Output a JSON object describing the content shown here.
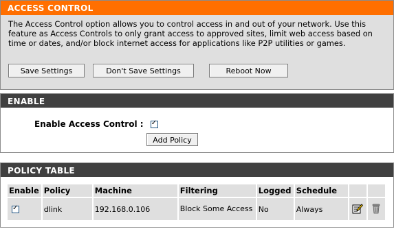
{
  "access_control": {
    "title": "ACCESS CONTROL",
    "description": "The Access Control option allows you to control access in and out of your network. Use this feature as Access Controls to only grant access to approved sites, limit web access based on time or dates, and/or block internet access for applications like P2P utilities or games.",
    "buttons": {
      "save": "Save Settings",
      "dont_save": "Don't Save Settings",
      "reboot": "Reboot Now"
    }
  },
  "enable": {
    "title": "ENABLE",
    "label": "Enable Access Control :",
    "checked": true,
    "add_policy": "Add Policy"
  },
  "policy_table": {
    "title": "POLICY TABLE",
    "columns": [
      "Enable",
      "Policy",
      "Machine",
      "Filtering",
      "Logged",
      "Schedule"
    ],
    "rows": [
      {
        "enable": true,
        "policy": "dlink",
        "machine": "192.168.0.106",
        "filtering": "Block Some Access",
        "logged": "No",
        "schedule": "Always"
      }
    ]
  },
  "colors": {
    "accent": "#ff6f00",
    "section_header": "#404040",
    "panel": "#dfdfdf"
  },
  "icons": [
    "edit-icon",
    "trash-icon"
  ]
}
